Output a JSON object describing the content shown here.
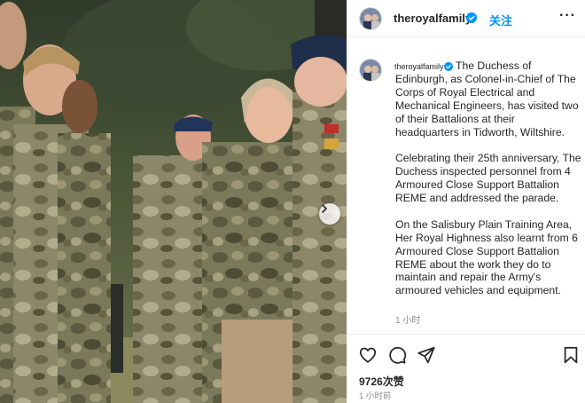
{
  "post": {
    "username": "theroyalfamily",
    "follow_label": "关注",
    "more_label": "···",
    "photo_alt": "The Duchess of Edinburgh speaking with soldiers in camouflage uniforms",
    "has_next_image": true
  },
  "caption": {
    "username": "theroyalfamily",
    "paragraphs": [
      "The Duchess of Edinburgh, as Colonel-in-Chief of The Corps of Royal Electrical and Mechanical Engineers, has visited two of their Battalions at their headquarters in Tidworth, Wiltshire.",
      "Celebrating their 25th anniversary, The Duchess inspected personnel from 4 Armoured Close Support Battalion REME and addressed the parade.",
      "On the Salisbury Plain Training Area, Her Royal Highness also learnt from 6 Armoured Close Support Battalion REME about the work they do to maintain and repair the Army's armoured vehicles and equipment."
    ],
    "time": "1 小时"
  },
  "actions": {
    "like_icon": "heart-icon",
    "comment_icon": "comment-icon",
    "share_icon": "paper-plane-icon",
    "save_icon": "bookmark-icon"
  },
  "stats": {
    "likes": "9726次赞",
    "posted": "1 小时前"
  },
  "colors": {
    "accent": "#0095f6",
    "text": "#262626",
    "muted": "#8e8e8e",
    "verified": "#0095f6"
  }
}
